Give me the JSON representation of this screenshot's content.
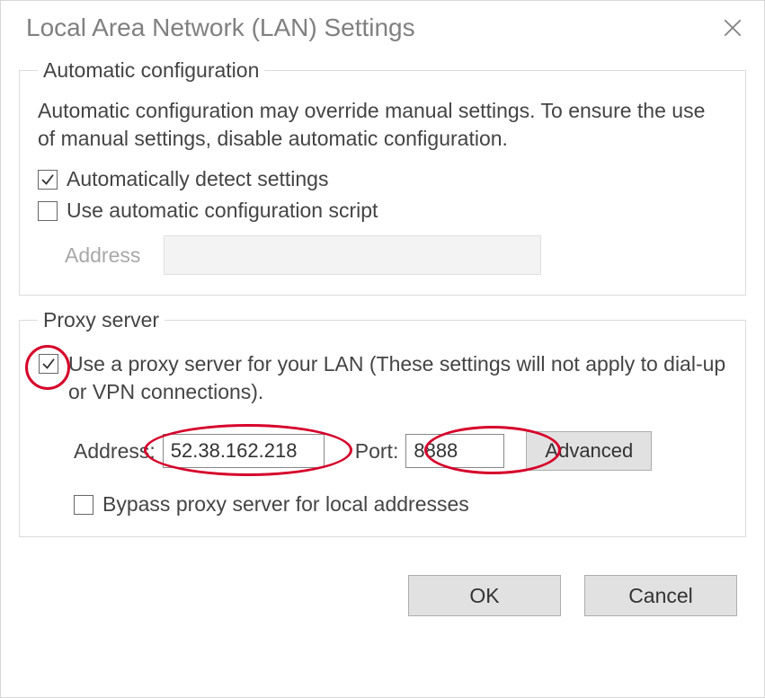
{
  "title": "Local Area Network (LAN) Settings",
  "auto": {
    "legend": "Automatic configuration",
    "desc": "Automatic configuration may override manual settings.  To ensure the use of manual settings, disable automatic configuration.",
    "detect_label": "Automatically detect settings",
    "detect_checked": true,
    "script_label": "Use automatic configuration script",
    "script_checked": false,
    "address_label": "Address",
    "address_value": ""
  },
  "proxy": {
    "legend": "Proxy server",
    "use_label": "Use a proxy server for your LAN (These settings will not apply to dial-up or VPN connections).",
    "use_checked": true,
    "address_label": "Address:",
    "address_value": "52.38.162.218",
    "port_label": "Port:",
    "port_value": "8888",
    "advanced_label": "Advanced",
    "bypass_label": "Bypass proxy server for local addresses",
    "bypass_checked": false
  },
  "buttons": {
    "ok": "OK",
    "cancel": "Cancel"
  },
  "annotations": {
    "color": "#d6002a"
  }
}
